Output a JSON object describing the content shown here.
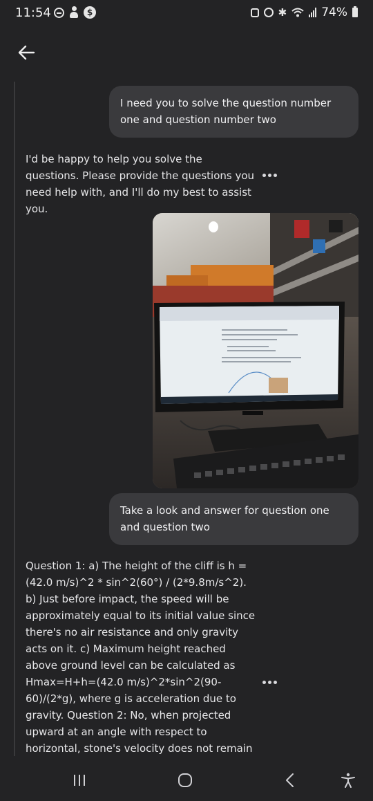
{
  "status_bar": {
    "time": "11:54",
    "battery": "74%",
    "icons": [
      "dnd-icon",
      "person-icon",
      "dollar-icon",
      "screenshot-icon",
      "alarm-icon",
      "bluetooth-icon",
      "wifi-icon",
      "signal-icon",
      "battery-icon"
    ]
  },
  "header": {
    "back_icon": "arrow-left-icon"
  },
  "messages": [
    {
      "role": "user",
      "text": "I need you to solve the question number one and question number two"
    },
    {
      "role": "assistant",
      "text": "I'd be happy to help you solve the questions. Please provide the questions you need help with, and I'll do my best to assist you."
    },
    {
      "role": "user",
      "type": "image",
      "icon": "photo-of-monitor-icon"
    },
    {
      "role": "user",
      "text": "Take a look and answer for question one and question two"
    },
    {
      "role": "assistant",
      "text": "Question 1: a) The height of the cliff is h = (42.0 m/s)^2 * sin^2(60°) / (2*9.8m/s^2). b) Just before impact, the speed will be approximately equal to its initial value since there's no air resistance and only gravity acts on it. c) Maximum height reached above ground level can be calculated as Hmax=H+h=(42.0 m/s)^2*sin^2(90-60)/(2*g), where g is acceleration due to gravity. Question 2: No, when projected upward at an angle with respect to horizontal, stone's velocity does not remain constant"
    }
  ],
  "more_icon": "more-horizontal-icon",
  "nav": {
    "recents_icon": "recents-icon",
    "home_icon": "home-icon",
    "back_icon": "nav-back-icon",
    "accessibility_icon": "accessibility-icon"
  }
}
